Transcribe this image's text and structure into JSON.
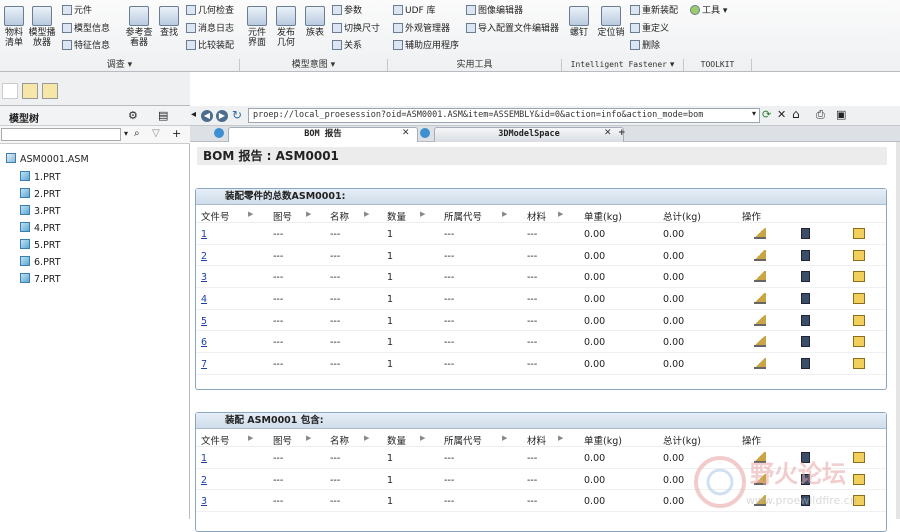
{
  "ribbon": {
    "big": [
      {
        "id": "bom",
        "label": "物料\n清单"
      },
      {
        "id": "model-player",
        "label": "模型播\n放器"
      },
      {
        "id": "ref-viewer",
        "label": "参考查\n看器"
      },
      {
        "id": "find",
        "label": "查找"
      },
      {
        "id": "publish-ui",
        "label": "元件\n界面"
      },
      {
        "id": "publish-geom",
        "label": "发布\n几何"
      },
      {
        "id": "table",
        "label": "族表"
      },
      {
        "id": "screw",
        "label": "螺钉"
      },
      {
        "id": "dowel",
        "label": "定位销"
      }
    ],
    "small": {
      "component": "元件",
      "model_info": "模型信息",
      "feature_info": "特征信息",
      "geom_check": "几何检查",
      "message_log": "消息日志",
      "compare_asm": "比较装配",
      "params": "参数",
      "switch_dims": "切换尺寸",
      "relations": "关系",
      "udf": "UDF 库",
      "appearance_mgr": "外观管理器",
      "aux_apps": "辅助应用程序",
      "image_editor": "图像编辑器",
      "import_config": "导入配置文件编辑器",
      "reassemble": "重新装配",
      "redefine": "重定义",
      "delete": "删除",
      "tools": "工具"
    },
    "groups": {
      "investigate": "调查",
      "model_intent": "模型意图",
      "utilities": "实用工具",
      "intelligent_fastener": "Intelligent Fastener",
      "toolkit": "TOOLKIT"
    }
  },
  "tree": {
    "title": "模型树",
    "root": "ASM0001.ASM",
    "items": [
      "1.PRT",
      "2.PRT",
      "3.PRT",
      "4.PRT",
      "5.PRT",
      "6.PRT",
      "7.PRT"
    ]
  },
  "browser": {
    "url": "proep://local_proesession?oid=ASM0001.ASM&item=ASSEMBLY&id=0&action=info&action_mode=bom",
    "tabs": [
      "BOM 报告",
      "3DModelSpace"
    ],
    "tab_add": "+"
  },
  "report": {
    "title": "BOM 报告 : ASM0001",
    "columns": [
      "文件号",
      "图号",
      "名称",
      "数量",
      "所属代号",
      "材料",
      "单重(kg)",
      "总计(kg)",
      "操作"
    ],
    "section1": {
      "header": "装配零件的总数ASM0001:",
      "rows": [
        [
          "1",
          "---",
          "---",
          "1",
          "---",
          "---",
          "0.00",
          "0.00"
        ],
        [
          "2",
          "---",
          "---",
          "1",
          "---",
          "---",
          "0.00",
          "0.00"
        ],
        [
          "3",
          "---",
          "---",
          "1",
          "---",
          "---",
          "0.00",
          "0.00"
        ],
        [
          "4",
          "---",
          "---",
          "1",
          "---",
          "---",
          "0.00",
          "0.00"
        ],
        [
          "5",
          "---",
          "---",
          "1",
          "---",
          "---",
          "0.00",
          "0.00"
        ],
        [
          "6",
          "---",
          "---",
          "1",
          "---",
          "---",
          "0.00",
          "0.00"
        ],
        [
          "7",
          "---",
          "---",
          "1",
          "---",
          "---",
          "0.00",
          "0.00"
        ]
      ]
    },
    "section2": {
      "header": "装配 ASM0001 包含:",
      "rows": [
        [
          "1",
          "---",
          "---",
          "1",
          "---",
          "---",
          "0.00",
          "0.00"
        ],
        [
          "2",
          "---",
          "---",
          "1",
          "---",
          "---",
          "0.00",
          "0.00"
        ],
        [
          "3",
          "---",
          "---",
          "1",
          "---",
          "---",
          "0.00",
          "0.00"
        ]
      ]
    }
  },
  "watermark": {
    "text": "野火论坛",
    "url": "www.proewildfire.cn"
  }
}
